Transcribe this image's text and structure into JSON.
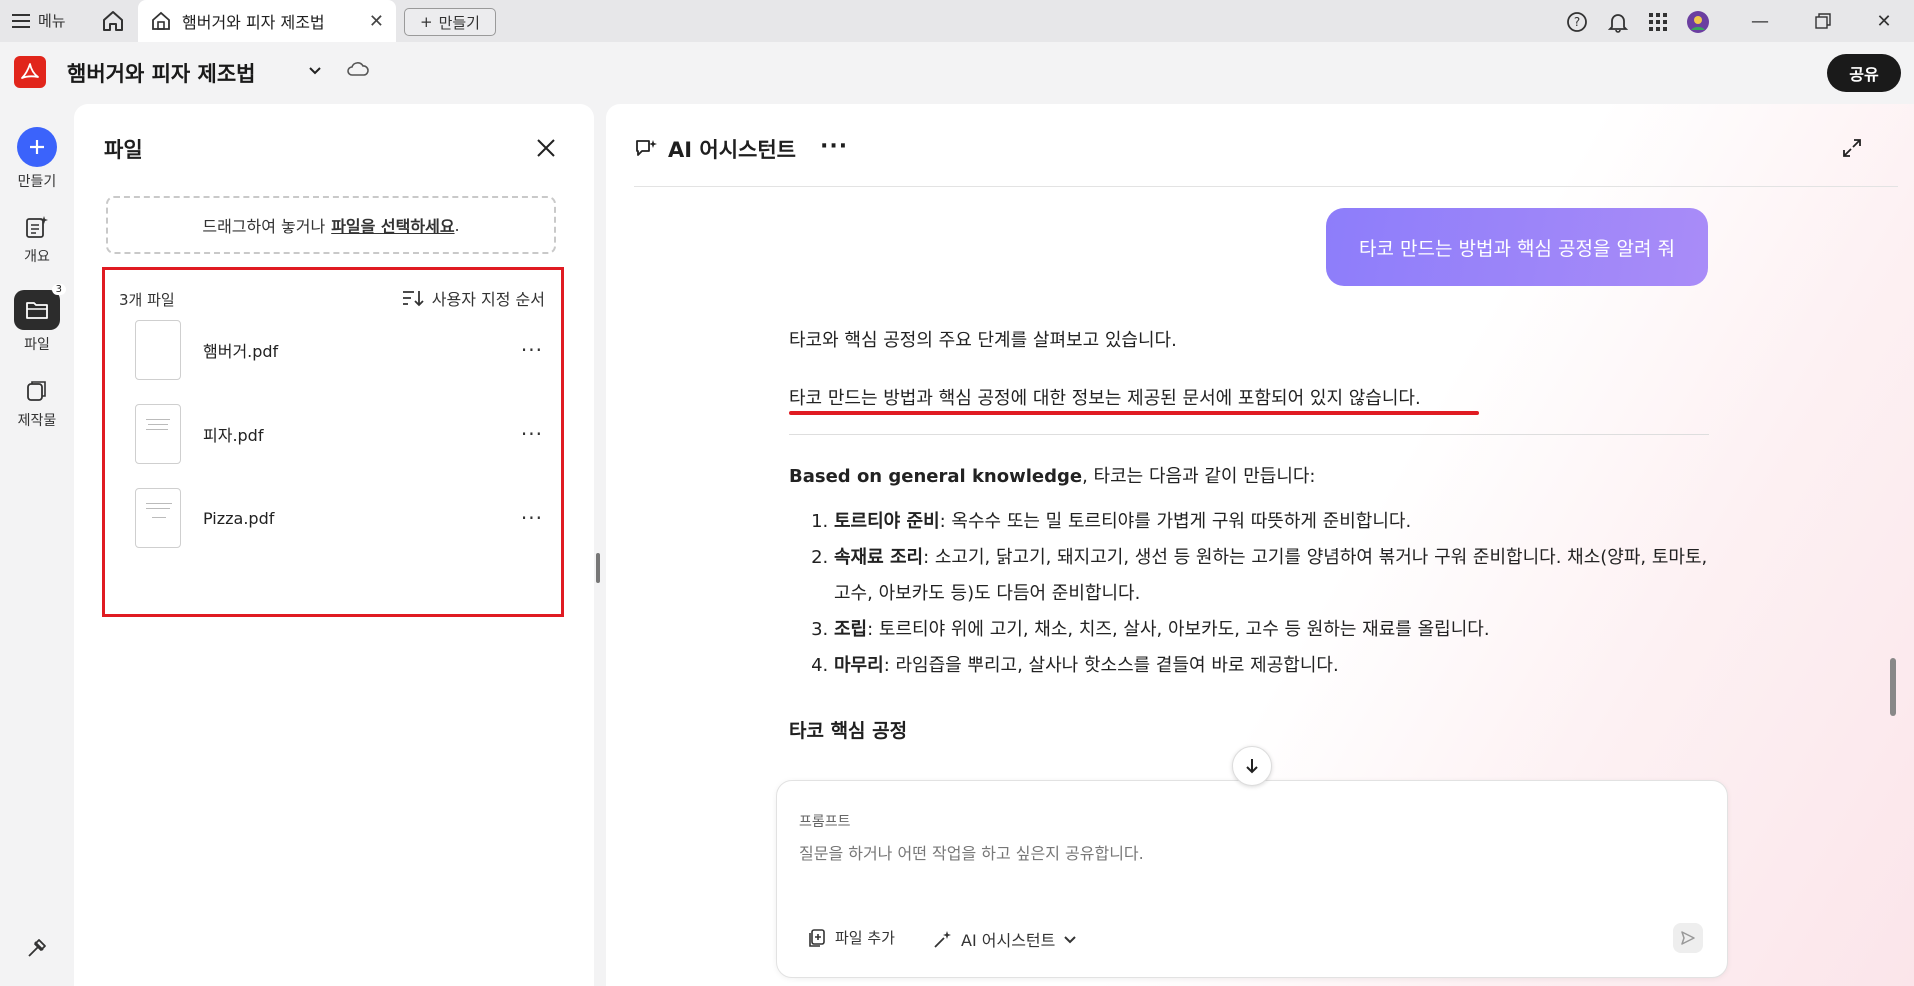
{
  "titlebar": {
    "menu_label": "메뉴",
    "tab_title": "햄버거와 피자 제조법",
    "new_label": "만들기"
  },
  "doc": {
    "title": "햄버거와 피자 제조법",
    "share_label": "공유"
  },
  "rail": {
    "create": "만들기",
    "overview": "개요",
    "files": "파일",
    "files_badge": "3",
    "outputs": "제작물"
  },
  "files_panel": {
    "title": "파일",
    "drop_text": "드래그하여 놓거나",
    "drop_link": "파일을 선택하세요",
    "drop_suffix": ".",
    "count": "3개 파일",
    "sort": "사용자 지정 순서",
    "files": [
      {
        "name": "햄버거.pdf"
      },
      {
        "name": "피자.pdf"
      },
      {
        "name": "Pizza.pdf"
      }
    ]
  },
  "ai": {
    "title": "AI 어시스턴트",
    "user_message": "타코 만드는 방법과 핵심 공정을 알려 줘",
    "status": "타코와 핵심 공정의 주요 단계를 살펴보고 있습니다.",
    "not_found": "타코 만드는 방법과 핵심 공정에 대한 정보는 제공된 문서에 포함되어 있지 않습니다.",
    "intro_bold": "Based on general knowledge",
    "intro_rest": ", 타코는 다음과 같이 만듭니다:",
    "steps": [
      {
        "title": "토르티야 준비",
        "text": ": 옥수수 또는 밀 토르티야를 가볍게 구워 따뜻하게 준비합니다."
      },
      {
        "title": "속재료 조리",
        "text": ": 소고기, 닭고기, 돼지고기, 생선 등 원하는 고기를 양념하여 볶거나 구워 준비합니다. 채소(양파, 토마토, 고수, 아보카도 등)도 다듬어 준비합니다."
      },
      {
        "title": "조립",
        "text": ": 토르티야 위에 고기, 채소, 치즈, 살사, 아보카도, 고수 등 원하는 재료를 올립니다."
      },
      {
        "title": "마무리",
        "text": ": 라임즙을 뿌리고, 살사나 핫소스를 곁들여 바로 제공합니다."
      }
    ],
    "section_heading": "타코 핵심 공정",
    "prompt_label": "프롬프트",
    "prompt_placeholder": "질문을 하거나 어떤 작업을 하고 싶은지 공유합니다.",
    "add_file": "파일 추가",
    "mode": "AI 어시스턴트"
  },
  "colors": {
    "accent": "#3b63fb",
    "highlight_border": "#e01b22",
    "bubble": "#8d7dfa",
    "adobe_red": "#e1251b"
  }
}
